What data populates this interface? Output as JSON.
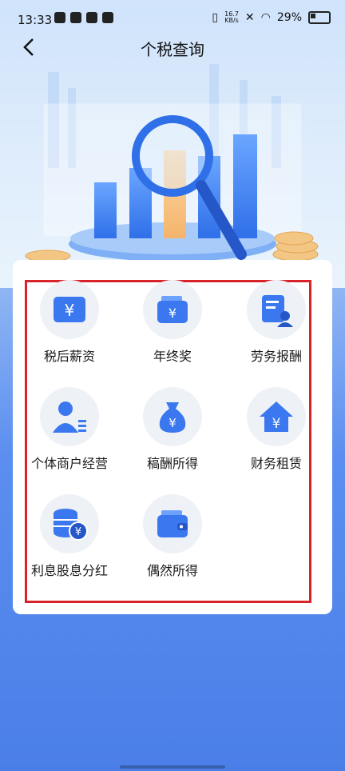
{
  "status_bar": {
    "time": "13:33",
    "net_speed_value": "16.7",
    "net_speed_unit": "KB/s",
    "battery": "29%"
  },
  "header": {
    "title": "个税查询",
    "back_icon": "chevron-left-icon"
  },
  "grid": {
    "items": [
      {
        "label": "税后薪资",
        "icon": "yen-briefcase-icon"
      },
      {
        "label": "年终奖",
        "icon": "yen-wallet-icon"
      },
      {
        "label": "劳务报酬",
        "icon": "worker-document-icon"
      },
      {
        "label": "个体商户经营",
        "icon": "person-business-icon"
      },
      {
        "label": "稿酬所得",
        "icon": "money-bag-icon"
      },
      {
        "label": "财务租赁",
        "icon": "house-yen-icon"
      },
      {
        "label": "利息股息分红",
        "icon": "coin-stack-icon"
      },
      {
        "label": "偶然所得",
        "icon": "wallet-icon"
      }
    ]
  },
  "colors": {
    "accent": "#3b78f0",
    "highlight_border": "#d8232a",
    "page_bg": "#4b7fe8"
  }
}
